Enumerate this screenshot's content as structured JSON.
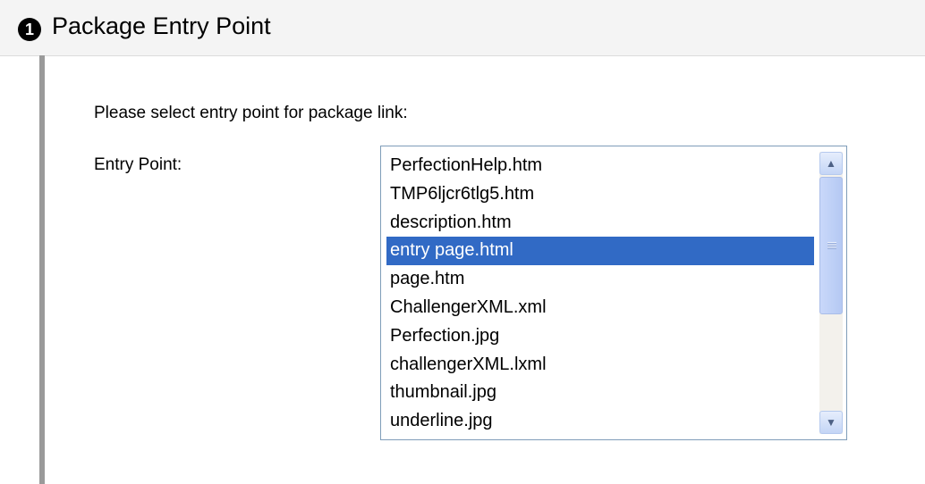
{
  "header": {
    "step_number": "1",
    "title": "Package Entry Point"
  },
  "form": {
    "prompt": "Please select entry point for package link:",
    "entry_point_label": "Entry Point:",
    "entry_point_selected": "entry page.html",
    "entry_point_options": [
      "PerfectionHelp.htm",
      "TMP6ljcr6tlg5.htm",
      "description.htm",
      "entry page.html",
      "page.htm",
      "ChallengerXML.xml",
      "Perfection.jpg",
      "challengerXML.lxml",
      "thumbnail.jpg",
      "underline.jpg"
    ]
  },
  "icons": {
    "scroll_up": "scroll-up-arrow-icon",
    "scroll_down": "scroll-down-arrow-icon"
  },
  "colors": {
    "selection": "#316ac5",
    "listbox_border": "#7f9db9",
    "scrollbar_thumb": "#c3d3fd"
  }
}
